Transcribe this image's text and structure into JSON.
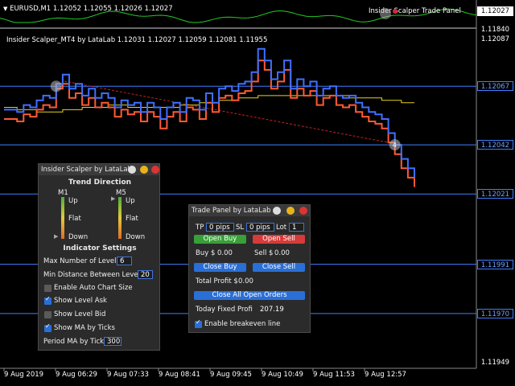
{
  "top_indicator": {
    "symbol_line": "EURUSD,M1  1.12052 1.12055 1.12026 1.12027",
    "panel_overlay_label": "Insider Scalper Trade Panel",
    "price_tag": "1.12027",
    "scale_label": "1.11840"
  },
  "indicator_title": "Insider Scalper_MT4 by LataLab 1.12031 1.12027 1.12059 1.12081 1.11955",
  "price_axis": {
    "labels": [
      {
        "text": "1.12087",
        "style": "plain",
        "price": 1.12087
      },
      {
        "text": "1.12067",
        "style": "blue",
        "price": 1.12067
      },
      {
        "text": "1.12042",
        "style": "blue",
        "price": 1.12042
      },
      {
        "text": "1.12021",
        "style": "blue",
        "price": 1.12021
      },
      {
        "text": "1.11991",
        "style": "blue",
        "price": 1.11991
      },
      {
        "text": "1.11970",
        "style": "blue",
        "price": 1.1197
      },
      {
        "text": "1.11949",
        "style": "plain",
        "price": 1.11949
      }
    ]
  },
  "time_axis": {
    "labels": [
      "9 Aug 2019",
      "9 Aug 06:29",
      "9 Aug 07:33",
      "9 Aug 08:41",
      "9 Aug 09:45",
      "9 Aug 10:49",
      "9 Aug 11:53",
      "9 Aug 12:57"
    ]
  },
  "colors": {
    "ask_line": "#3f6fff",
    "bid_line": "#ff5a33",
    "ma_line": "#e6d21a",
    "level_line": "#3f7fff",
    "dashed_trend": "#c42222",
    "top_indicator_line": "#22cc22"
  },
  "chart_data": {
    "type": "line",
    "levels": [
      1.12067,
      1.12042,
      1.12021,
      1.11991,
      1.1197
    ],
    "ylim": [
      1.11949,
      1.12087
    ],
    "markers": [
      {
        "label": "",
        "index": 8,
        "price": 1.12067
      },
      {
        "label": "4",
        "index": 60,
        "price": 1.12042
      }
    ],
    "series": [
      {
        "values": [
          1.12057,
          1.12057,
          1.12056,
          1.12059,
          1.12058,
          1.12061,
          1.12063,
          1.12062,
          1.12068,
          1.12072,
          1.12066,
          1.12068,
          1.12063,
          1.12066,
          1.12062,
          1.12064,
          1.12062,
          1.12058,
          1.12061,
          1.12059,
          1.1206,
          1.12056,
          1.1206,
          1.12058,
          1.12053,
          1.12058,
          1.1206,
          1.12056,
          1.12062,
          1.12061,
          1.12057,
          1.12064,
          1.1206,
          1.12066,
          1.12067,
          1.12065,
          1.12068,
          1.12069,
          1.12073,
          1.12083,
          1.12078,
          1.1207,
          1.12073,
          1.12078,
          1.12066,
          1.1207,
          1.12067,
          1.12069,
          1.12063,
          1.12066,
          1.12067,
          1.12063,
          1.12062,
          1.12063,
          1.1206,
          1.12058,
          1.12056,
          1.12055,
          1.12053,
          1.12047,
          1.12042,
          1.12036,
          1.12032,
          1.12028
        ]
      },
      {
        "values": [
          1.12053,
          1.12053,
          1.12052,
          1.12055,
          1.12054,
          1.12057,
          1.12059,
          1.12058,
          1.12066,
          1.12068,
          1.12062,
          1.12064,
          1.12059,
          1.12062,
          1.12058,
          1.1206,
          1.12058,
          1.12054,
          1.12057,
          1.12055,
          1.12056,
          1.12052,
          1.12056,
          1.12054,
          1.12049,
          1.12054,
          1.12056,
          1.12052,
          1.12058,
          1.12057,
          1.12053,
          1.1206,
          1.12056,
          1.12062,
          1.12063,
          1.12061,
          1.12064,
          1.12065,
          1.12069,
          1.12078,
          1.12074,
          1.12066,
          1.12069,
          1.12074,
          1.12062,
          1.12066,
          1.12063,
          1.12065,
          1.12059,
          1.12062,
          1.12063,
          1.12059,
          1.12058,
          1.12059,
          1.12056,
          1.12054,
          1.12052,
          1.12051,
          1.12049,
          1.12043,
          1.12038,
          1.12032,
          1.12028,
          1.12024
        ]
      },
      {
        "values": [
          1.12058,
          1.12058,
          1.12057,
          1.12057,
          1.12057,
          1.12056,
          1.12056,
          1.12056,
          1.12056,
          1.12057,
          1.12057,
          1.12057,
          1.12058,
          1.12058,
          1.12058,
          1.12058,
          1.12059,
          1.12059,
          1.12059,
          1.12058,
          1.12058,
          1.12058,
          1.12058,
          1.12058,
          1.12058,
          1.12058,
          1.12058,
          1.12059,
          1.12059,
          1.12059,
          1.1206,
          1.1206,
          1.1206,
          1.12061,
          1.12061,
          1.12061,
          1.12062,
          1.12062,
          1.12062,
          1.12063,
          1.12063,
          1.12063,
          1.12063,
          1.12063,
          1.12063,
          1.12063,
          1.12063,
          1.12063,
          1.12063,
          1.12063,
          1.12063,
          1.12063,
          1.12063,
          1.12062,
          1.12062,
          1.12062,
          1.12062,
          1.12062,
          1.12061,
          1.12061,
          1.12061,
          1.1206,
          1.1206,
          1.1206
        ]
      }
    ]
  },
  "scalper_panel": {
    "title": "Insider Scalper by LataLab",
    "trend_heading": "Trend Direction",
    "m1_label": "M1",
    "m5_label": "M5",
    "up": "Up",
    "flat": "Flat",
    "down": "Down",
    "indicator_heading": "Indicator Settings",
    "max_levels_label": "Max Number of Levels",
    "max_levels_value": "6",
    "min_distance_label": "Min Distance Between Levels",
    "min_distance_value": "20",
    "auto_size_label": "Enable Auto Chart Size",
    "auto_size_checked": false,
    "show_ask_label": "Show Level Ask",
    "show_ask_checked": true,
    "show_bid_label": "Show Level Bid",
    "show_bid_checked": false,
    "show_ma_label": "Show MA by Ticks",
    "show_ma_checked": true,
    "period_label": "Period MA by Ticks",
    "period_value": "300"
  },
  "trade_panel": {
    "title": "Trade Panel by LataLab",
    "tp_label": "TP",
    "tp_value": "0 pips",
    "sl_label": "SL",
    "sl_value": "0 pips",
    "lot_label": "Lot",
    "lot_value": "1",
    "open_buy": "Open Buy",
    "open_sell": "Open Sell",
    "buy_label": "Buy $",
    "buy_value": "0.00",
    "sell_label": "Sell $",
    "sell_value": "0.00",
    "close_buy": "Close Buy",
    "close_sell": "Close Sell",
    "total_profit_label": "Total Profit $",
    "total_profit_value": "0.00",
    "close_all": "Close All Open Orders",
    "today_fixed_label": "Today Fixed Profit $",
    "today_fixed_value": "207.19",
    "breakeven_label": "Enable breakeven line",
    "breakeven_checked": true
  }
}
